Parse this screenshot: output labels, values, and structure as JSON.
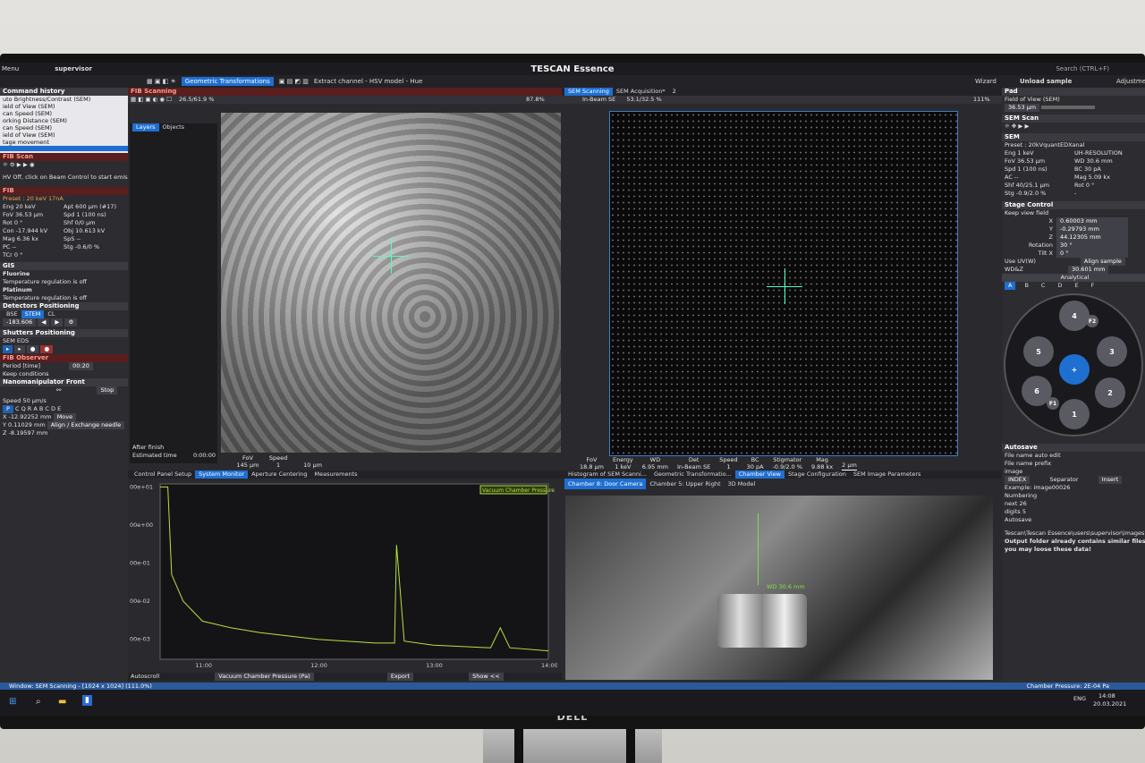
{
  "app": {
    "title": "TESCAN Essence",
    "user": "supervisor",
    "menu": "Menu"
  },
  "toolbar": {
    "geometric": "Geometric Transformations",
    "extract": "Extract channel - HSV model - Hue",
    "wizard": "Wizard",
    "unload": "Unload sample",
    "search_placeholder": "Search (CTRL+F)",
    "adjust": "Adjustme"
  },
  "left": {
    "cmd_history_title": "Command history",
    "cmd_history": [
      "uto Brightness/Contrast (SEM)",
      "ield of View (SEM)",
      "can Speed (SEM)",
      "orking Distance (SEM)",
      "can Speed (SEM)",
      "ield of View (SEM)",
      "tage movement"
    ],
    "fib_scan_title": "FIB Scan",
    "fib_msg": "HV Off, click on Beam Control to start emission",
    "fib_title": "FIB",
    "fib_preset": "Preset : 20 keV 17nA",
    "fib_params": [
      [
        "Eng 20 keV",
        "Apt 600 µm (#17)"
      ],
      [
        "FoV 36.53 µm",
        "Spd 1 (100 ns)"
      ],
      [
        "Rot 0 °",
        "Shf 0/0 µm"
      ],
      [
        "Con -17.944 kV",
        "Obj 10.613 kV"
      ],
      [
        "Mag 6.36 kx",
        "SpS --"
      ],
      [
        "PC --",
        "Stg -0.6/0 %"
      ],
      [
        "TCr 0 °",
        ""
      ]
    ],
    "gis_title": "GIS",
    "gis_items": [
      {
        "name": "Fluorine",
        "status": "Temperature regulation is off"
      },
      {
        "name": "Platinum",
        "status": "Temperature regulation is off"
      }
    ],
    "detectors_title": "Detectors Positioning",
    "detector_tabs": [
      "BSE",
      "STEM",
      "CL"
    ],
    "detector_value": "-183.606",
    "shutters_title": "Shutters Positioning",
    "shutter_label": "SEM EDS",
    "observer_title": "FIB Observer",
    "period_label": "Period [time]",
    "period_value": "00:20",
    "keep_conditions": "Keep conditions",
    "nano_title": "Nanomanipulator Front",
    "stop": "Stop",
    "speed": "Speed 50 µm/s",
    "move": "Move",
    "align": "Align / Exchange needle",
    "coords": [
      "X -12.92252 mm",
      "Y 0.11029 mm",
      "Z -8.19597 mm"
    ]
  },
  "fib_view": {
    "tab": "FIB Scanning",
    "zoom_info": "26.5/61.9 %",
    "zoom": "87.8%",
    "layers_tabs": [
      "Layers",
      "Objects"
    ],
    "after_finish": "After finish",
    "estimated": "Estimated time",
    "estimated_value": "0:00:00",
    "fov_label": "FoV",
    "fov_value": "145 µm",
    "speed_label": "Speed",
    "speed_value": "1",
    "scalebar": "10 µm"
  },
  "sem_view": {
    "tabs": [
      "SEM Scanning",
      "SEM Acquisition*",
      "2"
    ],
    "detector": "In-Beam SE",
    "zoom_info": "53.1/32.5 %",
    "zoom": "111%",
    "info_labels": [
      "FoV",
      "Energy",
      "WD",
      "Det",
      "Speed",
      "BC",
      "Stigmator",
      "Mag"
    ],
    "info_values": [
      "18.8 µm",
      "1 keV",
      "6.95 mm",
      "In-Beam SE",
      "1",
      "30 pA",
      "-0.9/2.0 %",
      "9.88 kx"
    ],
    "scalebar": "2 µm"
  },
  "graph": {
    "tabs": [
      "Control Panel Setup",
      "System Monitor",
      "Aperture Centering",
      "Measurements"
    ],
    "legend": "Vacuum Chamber Pressure",
    "y_ticks": [
      "00e+01",
      "00e+00",
      "00e-01",
      "00e-02",
      "00e-03"
    ],
    "x_ticks": [
      "11:00",
      "12:00",
      "13:00",
      "14:00"
    ],
    "autoscroll": "Autoscroll",
    "selector": "Vacuum Chamber Pressure (Pa)",
    "export": "Export",
    "show": "Show <<"
  },
  "chamber": {
    "tabs": [
      "Histogram of SEM Scanni...",
      "Geometric Transformatio...",
      "Chamber View",
      "Stage Configuration",
      "SEM Image Parameters"
    ],
    "camera_tabs": [
      "Chamber 8: Door Camera",
      "Chamber 5: Upper Right",
      "3D Model"
    ],
    "wd_label": "WD 30.6 mm"
  },
  "right": {
    "pad_title": "Pad",
    "fov_select": "Field of View (SEM)",
    "fov_value": "36.53 µm",
    "sem_scan_title": "SEM Scan",
    "sem_title": "SEM",
    "preset": "Preset : 20kVquantEDXanal",
    "params": [
      [
        "Eng 1 keV",
        "UH-RESOLUTION"
      ],
      [
        "FoV 36.53 µm",
        "WD 30.6 mm"
      ],
      [
        "Spd 1 (100 ns)",
        "BC 30 pA"
      ],
      [
        "AC --",
        "Mag 5.09 kx"
      ],
      [
        "Shf 40/25.1 µm",
        "Rot 0 °"
      ],
      [
        "Stg -0.9/2.0 %",
        "-"
      ]
    ],
    "stage_title": "Stage Control",
    "keep_view": "Keep view field",
    "stage": [
      [
        "X",
        "0.60003 mm"
      ],
      [
        "Y",
        "-0.29793 mm"
      ],
      [
        "Z",
        "44.12305 mm"
      ],
      [
        "Rotation",
        "30 °"
      ],
      [
        "Tilt X",
        "0 °"
      ]
    ],
    "use_uv": "Use UV(W)",
    "align_sample": "Align sample",
    "wdz_label": "WD&Z",
    "wdz_value": "30.601 mm",
    "analytical": "Analytical",
    "letters": [
      "A",
      "B",
      "C",
      "D",
      "E",
      "F"
    ],
    "carousel": [
      "4",
      "F2",
      "3",
      "5",
      "+",
      "2",
      "6",
      "F1",
      "1"
    ],
    "autosave_title": "Autosave",
    "file_auto": "File name auto edit",
    "prefix_label": "File name prefix",
    "prefix": "image",
    "index": "INDEX",
    "separator": "Separator",
    "insert": "Insert",
    "example": "Example: image00026",
    "numbering": "Numbering",
    "next": "next  26",
    "digits": "digits  5",
    "autosave": "Autosave",
    "path": "Tescan\\Tescan Essence\\users\\supervisor\\images",
    "warn1": "Output folder already contains similar files,",
    "warn2": "you may loose these data!"
  },
  "status": {
    "window": "Window: SEM Scanning - [1024 x 1024] (111.0%)",
    "pressure": "Chamber Pressure: 2E-04 Pa"
  },
  "taskbar": {
    "lang": "ENG",
    "time": "14:08",
    "date": "20.03.2021"
  },
  "monitor_brand": "DELL",
  "chart_data": {
    "type": "line",
    "title": "",
    "xlabel": "",
    "ylabel": "",
    "x": [
      "10:38",
      "10:42",
      "10:44",
      "10:50",
      "11:00",
      "11:15",
      "11:30",
      "12:00",
      "12:30",
      "12:40",
      "12:41",
      "12:45",
      "13:00",
      "13:30",
      "13:35",
      "13:40",
      "14:00"
    ],
    "series": [
      {
        "name": "Vacuum Chamber Pressure",
        "values": [
          10,
          10,
          0.05,
          0.01,
          0.003,
          0.002,
          0.0015,
          0.001,
          0.0008,
          0.0008,
          0.3,
          0.0009,
          0.0007,
          0.0006,
          0.002,
          0.0006,
          0.0005
        ]
      }
    ],
    "ylim": [
      0.0003,
      12
    ],
    "yscale": "log"
  }
}
